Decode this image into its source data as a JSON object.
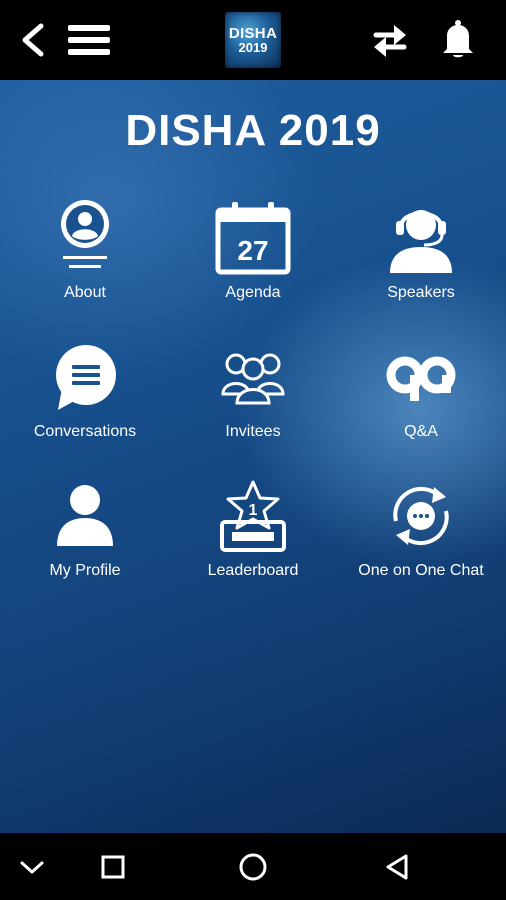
{
  "app": {
    "logo_line1": "DISHA",
    "logo_line2": "2019",
    "title": "DISHA 2019"
  },
  "toolbar": {
    "back_icon": "chevron-left-icon",
    "menu_icon": "hamburger-menu-icon",
    "sync_icon": "sync-arrows-icon",
    "notification_icon": "bell-icon"
  },
  "menu": {
    "items": [
      {
        "label": "About",
        "icon": "profile-card-icon"
      },
      {
        "label": "Agenda",
        "icon": "calendar-icon",
        "day": "27"
      },
      {
        "label": "Speakers",
        "icon": "headset-icon"
      },
      {
        "label": "Conversations",
        "icon": "chat-bubble-icon"
      },
      {
        "label": "Invitees",
        "icon": "group-icon"
      },
      {
        "label": "Q&A",
        "icon": "qa-icon"
      },
      {
        "label": "My Profile",
        "icon": "user-icon"
      },
      {
        "label": "Leaderboard",
        "icon": "trophy-star-icon",
        "rank": "1"
      },
      {
        "label": "One on One Chat",
        "icon": "chat-cycle-icon"
      }
    ]
  },
  "system_nav": {
    "icons": [
      "chevron-down-icon",
      "recents-square-icon",
      "home-circle-icon",
      "back-triangle-icon"
    ]
  },
  "colors": {
    "topbar": "#000000",
    "background_top": "#1f5d9e",
    "background_bottom": "#0b2a55",
    "icon": "#ffffff",
    "text": "#ffffff"
  }
}
